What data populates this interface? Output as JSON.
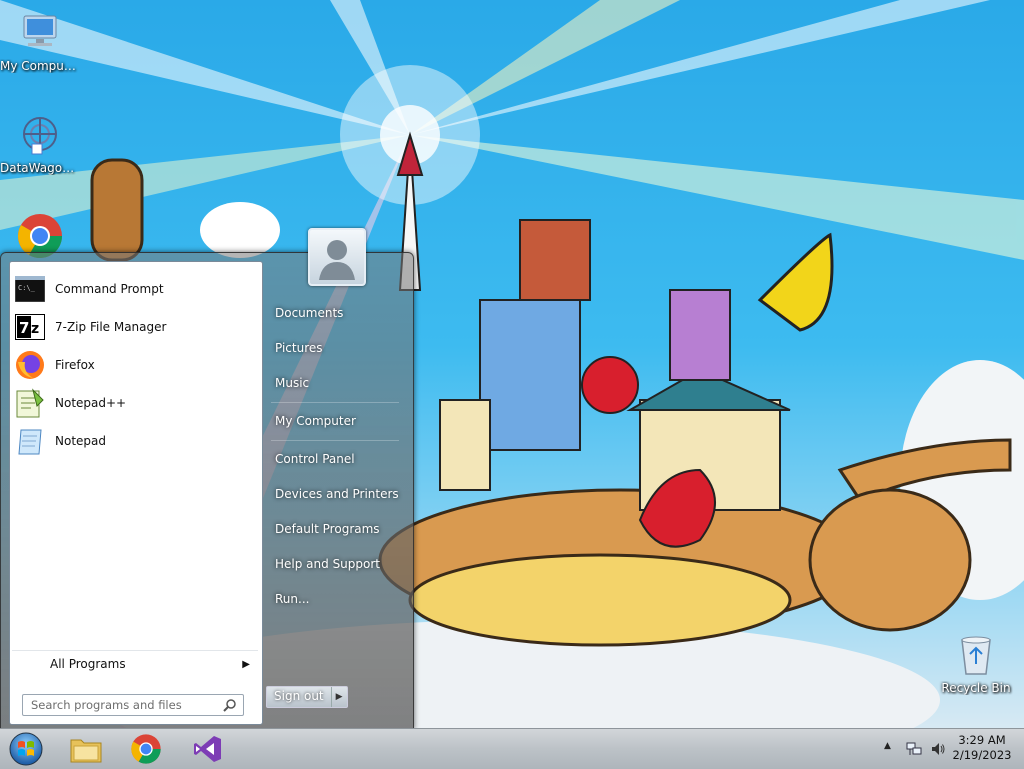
{
  "desktop": {
    "icons": [
      {
        "label": "My Computer"
      },
      {
        "label": "DataWagon..."
      },
      {
        "label": "Recycle Bin"
      }
    ]
  },
  "start_menu": {
    "programs": [
      {
        "label": "Command Prompt",
        "icon": "command-prompt-icon"
      },
      {
        "label": "7-Zip File Manager",
        "icon": "7zip-icon"
      },
      {
        "label": "Firefox",
        "icon": "firefox-icon"
      },
      {
        "label": "Notepad++",
        "icon": "notepadpp-icon"
      },
      {
        "label": "Notepad",
        "icon": "notepad-icon"
      }
    ],
    "all_programs": "All Programs",
    "search_placeholder": "Search programs and files",
    "right_items": [
      "Documents",
      "Pictures",
      "Music",
      "My Computer",
      "Control Panel",
      "Devices and Printers",
      "Default Programs",
      "Help and Support",
      "Run..."
    ],
    "sign_out": "Sign out"
  },
  "taskbar": {
    "pinned": [
      "start-orb",
      "file-explorer-icon",
      "chrome-icon",
      "visual-studio-icon"
    ],
    "clock_time": "3:29 AM",
    "clock_date": "2/19/2023"
  },
  "colors": {
    "sky": "#2aa9e8",
    "start_orb": "#2b7fd4",
    "vs_purple": "#7d3cb5"
  }
}
